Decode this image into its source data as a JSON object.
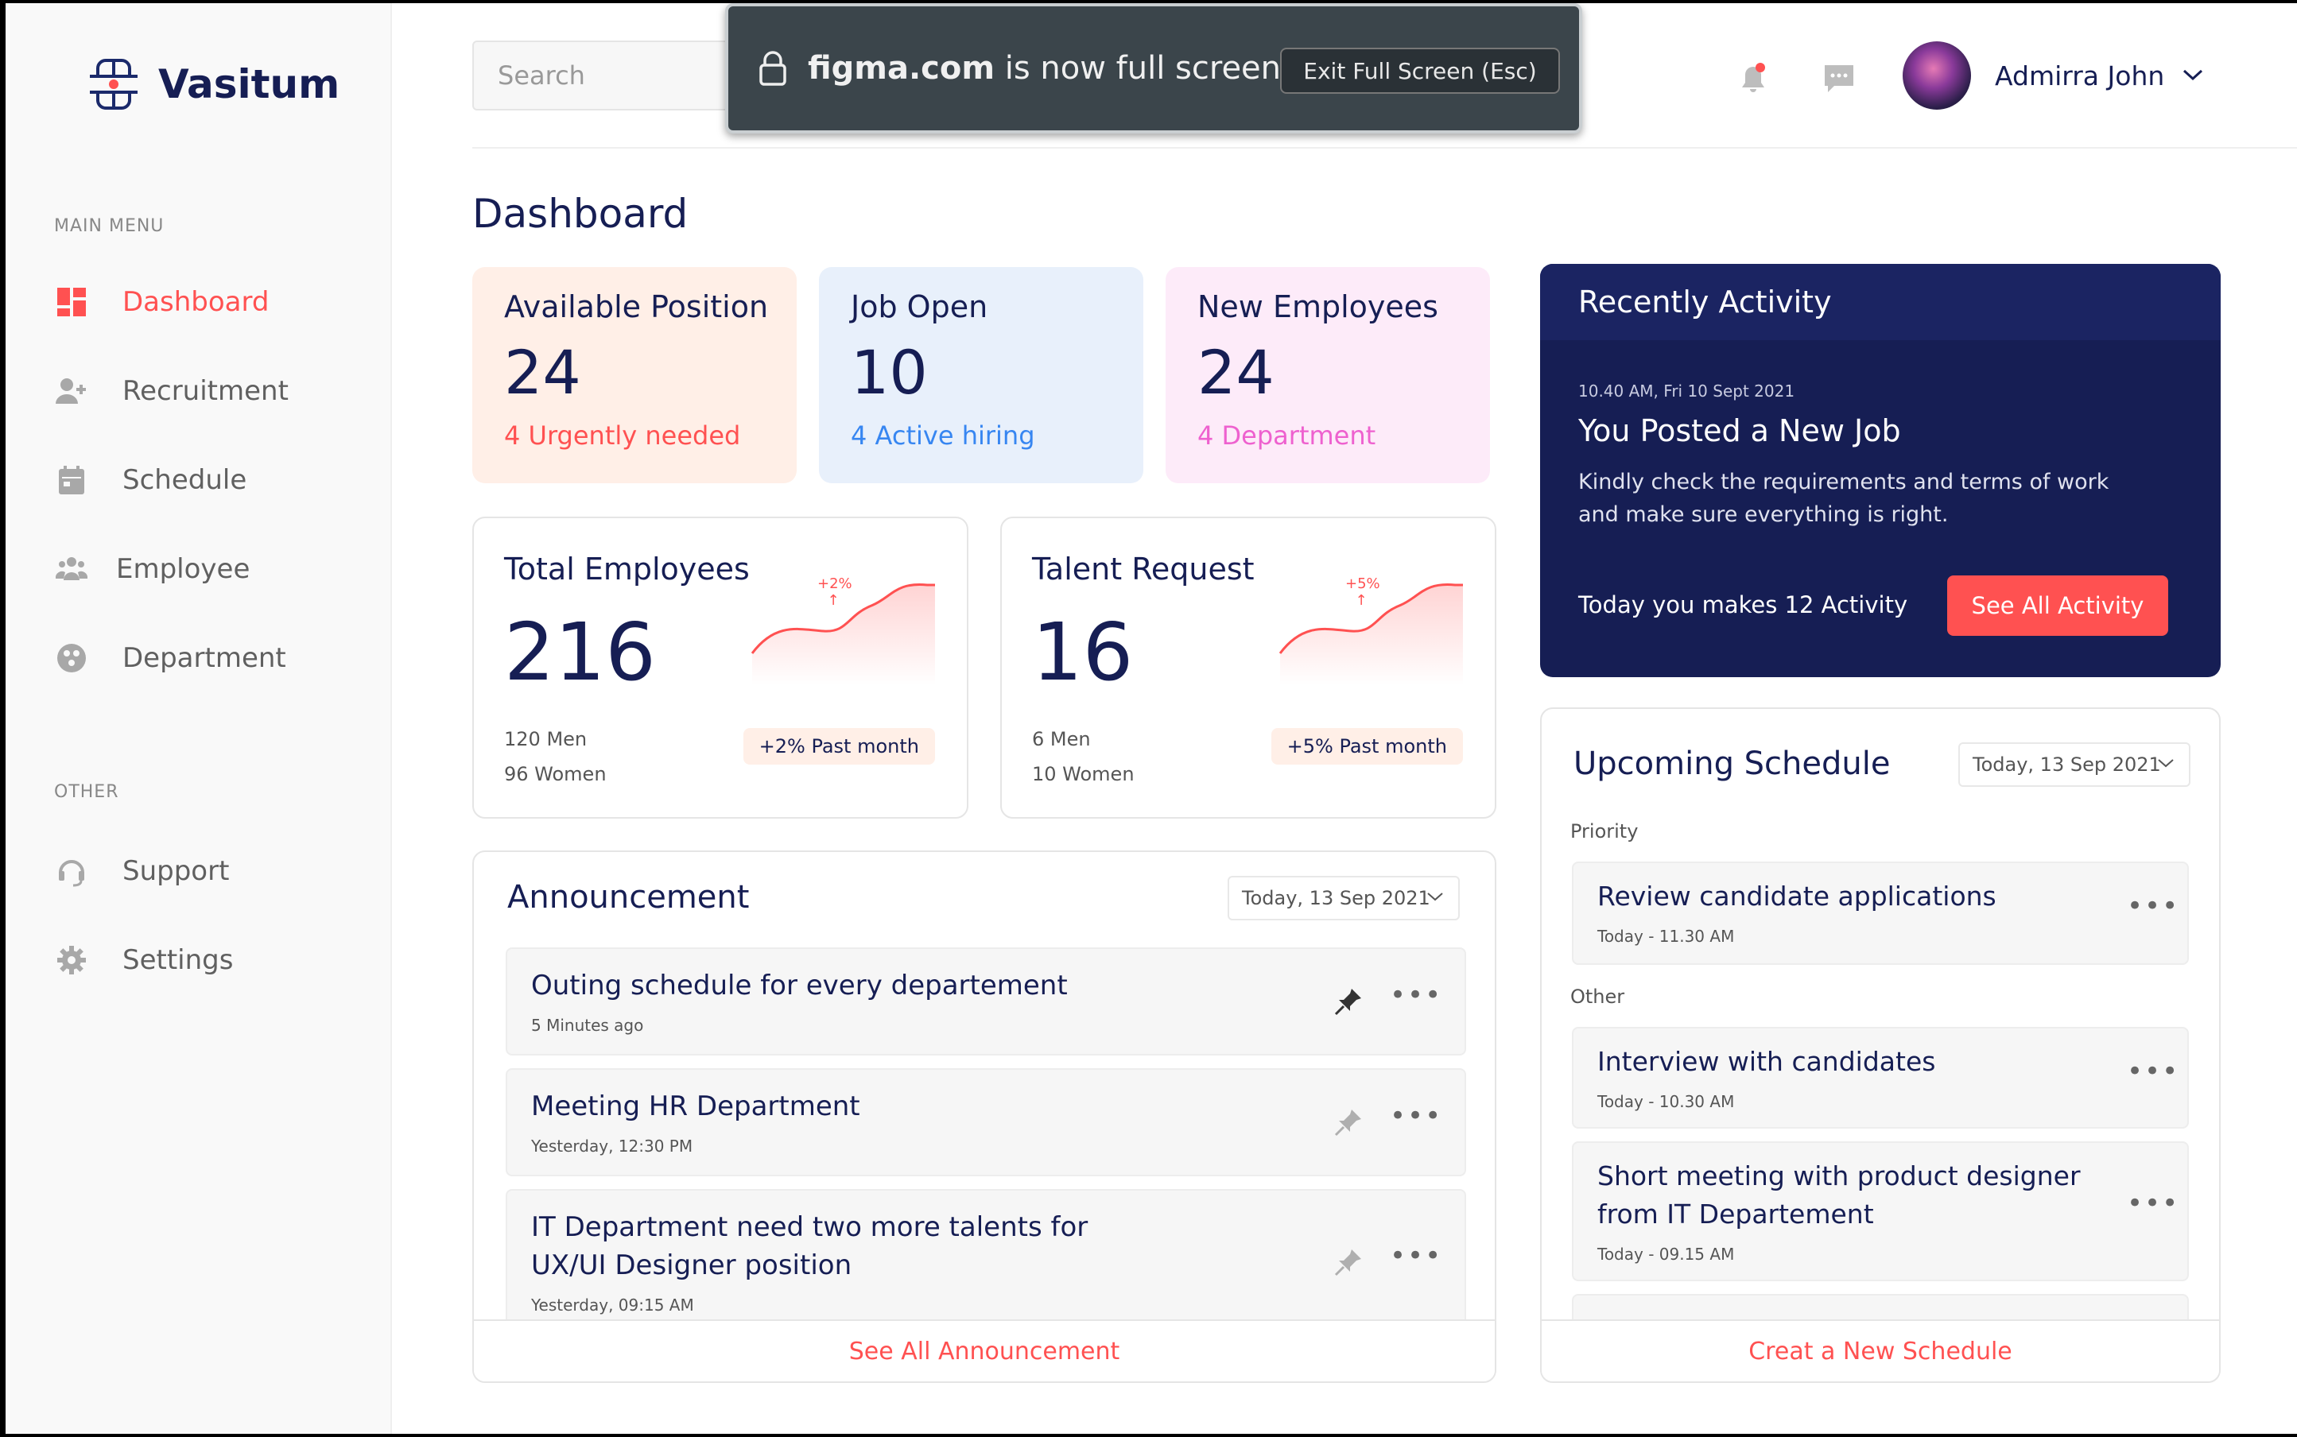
{
  "fullscreen_toast": {
    "domain": "figma.com",
    "message": "is now full screen",
    "exit_button": "Exit Full Screen (Esc)"
  },
  "brand": {
    "name": "Vasitum"
  },
  "sidebar": {
    "main_menu_label": "MAIN MENU",
    "main_items": [
      {
        "label": "Dashboard",
        "icon": "dashboard-icon",
        "active": true
      },
      {
        "label": "Recruitment",
        "icon": "add-user-icon"
      },
      {
        "label": "Schedule",
        "icon": "calendar-icon"
      },
      {
        "label": "Employee",
        "icon": "people-icon"
      },
      {
        "label": "Department",
        "icon": "department-icon"
      }
    ],
    "other_label": "OTHER",
    "other_items": [
      {
        "label": "Support",
        "icon": "headset-icon"
      },
      {
        "label": "Settings",
        "icon": "gear-icon"
      }
    ]
  },
  "topbar": {
    "search_placeholder": "Search",
    "user_name": "Admirra John"
  },
  "page_title": "Dashboard",
  "stats": [
    {
      "title": "Available Position",
      "value": "24",
      "sub": "4 Urgently needed",
      "bg": "#FFEFE7",
      "sub_color": "#FF5151"
    },
    {
      "title": "Job Open",
      "value": "10",
      "sub": "4 Active hiring",
      "bg": "#E8F0FB",
      "sub_color": "#3786F1"
    },
    {
      "title": "New Employees",
      "value": "24",
      "sub": "4 Department",
      "bg": "#FDEBF9",
      "sub_color": "#EE61CF"
    }
  ],
  "employee_cards": [
    {
      "title": "Total Employees",
      "value": "216",
      "line1": "120 Men",
      "line2": "96 Women",
      "change": "+2%",
      "pill": "+2% Past month"
    },
    {
      "title": "Talent Request",
      "value": "16",
      "line1": "6 Men",
      "line2": "10 Women",
      "change": "+5%",
      "pill": "+5% Past month"
    }
  ],
  "announcement": {
    "title": "Announcement",
    "date": "Today, 13 Sep 2021",
    "items": [
      {
        "title": "Outing schedule for every departement",
        "time": "5 Minutes ago",
        "pinned": true
      },
      {
        "title": "Meeting HR Department",
        "time": "Yesterday, 12:30 PM",
        "pinned": false
      },
      {
        "title": "IT Department need two more talents for UX/UI Designer position",
        "time": "Yesterday, 09:15 AM",
        "pinned": false
      }
    ],
    "footer": "See All Announcement"
  },
  "activity": {
    "title": "Recently Activity",
    "time": "10.40 AM, Fri 10 Sept 2021",
    "headline": "You Posted a New Job",
    "description": "Kindly check the requirements and terms of work and make sure everything is right.",
    "count_text": "Today you makes 12 Activity",
    "button": "See All Activity"
  },
  "schedule": {
    "title": "Upcoming Schedule",
    "date": "Today, 13 Sep 2021",
    "priority_label": "Priority",
    "other_label": "Other",
    "priority_items": [
      {
        "title": "Review candidate applications",
        "time": "Today - 11.30 AM"
      }
    ],
    "other_items": [
      {
        "title": "Interview with candidates",
        "time": "Today - 10.30 AM"
      },
      {
        "title": "Short meeting with product designer from IT Departement",
        "time": "Today - 09.15 AM"
      }
    ],
    "footer": "Creat a New Schedule"
  },
  "colors": {
    "primary": "#161E54",
    "accent": "#FF5151",
    "sidebar_bg": "#F9F9F9"
  }
}
